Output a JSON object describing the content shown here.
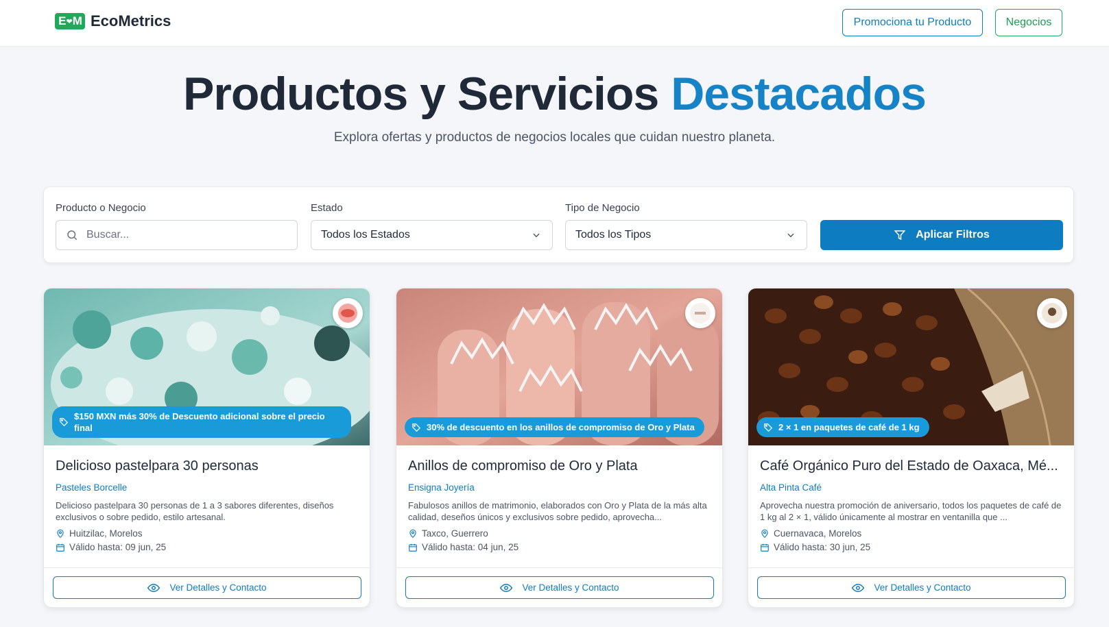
{
  "header": {
    "logo_mark": "E M",
    "brand": "EcoMetrics",
    "promo_button": "Promociona tu Producto",
    "business_button": "Negocios"
  },
  "hero": {
    "title_main": "Productos y Servicios",
    "title_accent": "Destacados",
    "subtitle": "Explora ofertas y productos de negocios locales que cuidan nuestro planeta."
  },
  "filters": {
    "search_label": "Producto o Negocio",
    "search_placeholder": "Buscar...",
    "state_label": "Estado",
    "state_value": "Todos los Estados",
    "type_label": "Tipo de Negocio",
    "type_value": "Todos los Tipos",
    "apply_label": "Aplicar Filtros"
  },
  "cards": [
    {
      "promo": "$150 MXN más 30% de Descuento adicional sobre el precio final",
      "title": "Delicioso pastelpara 30 personas",
      "business": "Pasteles Borcelle",
      "description": "Delicioso pastelpara 30 personas de 1 a 3 sabores diferentes, diseños exclusivos o sobre pedido, estilo artesanal.",
      "location": "Huitzilac, Morelos",
      "valid": "Válido hasta: 09 jun, 25",
      "button": "Ver Detalles y Contacto"
    },
    {
      "promo": "30% de descuento en los anillos de compromiso de Oro y Plata",
      "title": "Anillos de compromiso de Oro y Plata",
      "business": "Ensigna Joyería",
      "description": "Fabulosos anillos de matrimonio, elaborados con Oro y Plata de la más alta calidad, deseños únicos y exclusivos sobre pedido, aprovecha...",
      "location": "Taxco, Guerrero",
      "valid": "Válido hasta: 04 jun, 25",
      "button": "Ver Detalles y Contacto"
    },
    {
      "promo": "2 × 1 en paquetes de café de 1 kg",
      "title": "Café Orgánico Puro del Estado de Oaxaca, Mé...",
      "business": "Alta Pinta Café",
      "description": "Aprovecha nuestra promoción de aniversario, todos los paquetes de café de 1 kg al 2 × 1, válido únicamente al mostrar en ventanilla que ...",
      "location": "Cuernavaca, Morelos",
      "valid": "Válido hasta: 30 jun, 25",
      "button": "Ver Detalles y Contacto"
    }
  ],
  "colors": {
    "primary": "#0e7cc1",
    "brand_green": "#22a85a",
    "badge": "#1a9bd9"
  }
}
